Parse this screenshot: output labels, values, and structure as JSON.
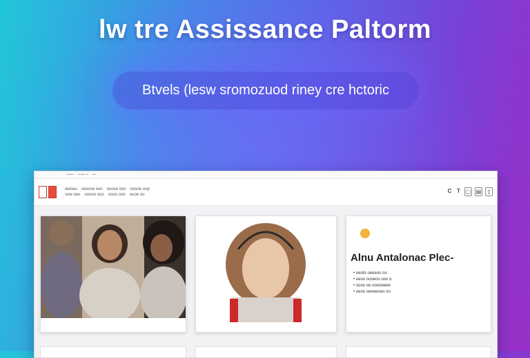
{
  "hero": {
    "title": "lw tre Assissance Paltorm",
    "subtitle": "Btvels (lesw sromozuod riney cre hctoric"
  },
  "window": {
    "titlebar_texts": [
      "••••••",
      "•••••• ••",
      "•••"
    ],
    "toolbar": {
      "row1": [
        "awoao",
        "xeoone ees",
        "ouose oos",
        "ooooe oop"
      ],
      "row2": [
        "sow oeo",
        "ooooo ooo",
        "oooo ooo",
        "ouoe oo"
      ],
      "icons": [
        "C",
        "T",
        "▢",
        "▤",
        "▯"
      ]
    },
    "cards": [
      {
        "kind": "photo",
        "subject": "group-of-three-women"
      },
      {
        "kind": "photo",
        "subject": "woman-portrait"
      },
      {
        "kind": "text",
        "title": "Alnu Antalonac Plec-",
        "lines": [
          "• oeoto oeeeoo oo",
          "• oeoo oooeoo ooo o",
          "• oooo oo ooooeeee",
          "• oeoo oeeoeooo oo"
        ]
      }
    ]
  },
  "colors": {
    "background_start": "#22c7d9",
    "background_end": "#9a2fc6",
    "accent": "#5b63e6"
  }
}
